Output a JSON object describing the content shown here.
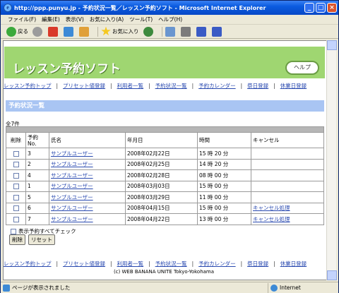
{
  "window": {
    "title": "http://ppp.punyu.jp - 予約状況一覧／レッスン予約ソフト - Microsoft Internet Explorer"
  },
  "menu": [
    "ファイル(F)",
    "編集(E)",
    "表示(V)",
    "お気に入り(A)",
    "ツール(T)",
    "ヘルプ(H)"
  ],
  "toolbar": {
    "back": "戻る",
    "favorites": "お気に入り"
  },
  "app": {
    "logo": "レッスン予約ソフト",
    "help": "ヘルプ"
  },
  "nav": [
    "レッスン予約トップ",
    "プリセット値登録",
    "利用者一覧",
    "予約状況一覧",
    "予約カレンダー",
    "祭日登録",
    "休業日登録"
  ],
  "section_title": "予約状況一覧",
  "count": "全7件",
  "table": {
    "headers": [
      "削除",
      "予約\nNo.",
      "氏名",
      "年月日",
      "時間",
      "キャンセル"
    ],
    "rows": [
      {
        "no": "3",
        "name": "サンプルユーザー",
        "date": "2008年02月22日",
        "time": "15 時 20 分",
        "cancel": ""
      },
      {
        "no": "2",
        "name": "サンプルユーザー",
        "date": "2008年02月25日",
        "time": "14 時 20 分",
        "cancel": ""
      },
      {
        "no": "4",
        "name": "サンプルユーザー",
        "date": "2008年02月28日",
        "time": "08 時 00 分",
        "cancel": ""
      },
      {
        "no": "1",
        "name": "サンプルユーザー",
        "date": "2008年03月03日",
        "time": "15 時 00 分",
        "cancel": ""
      },
      {
        "no": "5",
        "name": "サンプルユーザー",
        "date": "2008年03月29日",
        "time": "11 時 00 分",
        "cancel": ""
      },
      {
        "no": "6",
        "name": "サンプルユーザー",
        "date": "2008年04月15日",
        "time": "15 時 00 分",
        "cancel": "キャンセル処理"
      },
      {
        "no": "7",
        "name": "サンプルユーザー",
        "date": "2008年04月22日",
        "time": "13 時 00 分",
        "cancel": "キャンセル処理"
      }
    ]
  },
  "check_all": "表示予約すべてチェック",
  "buttons": {
    "delete": "削除",
    "reset": "リセット"
  },
  "copyright": "(c) WEB BANANA UNITE Tokyo-Yokohama",
  "status": {
    "text": "ページが表示されました",
    "zone": "Internet"
  }
}
